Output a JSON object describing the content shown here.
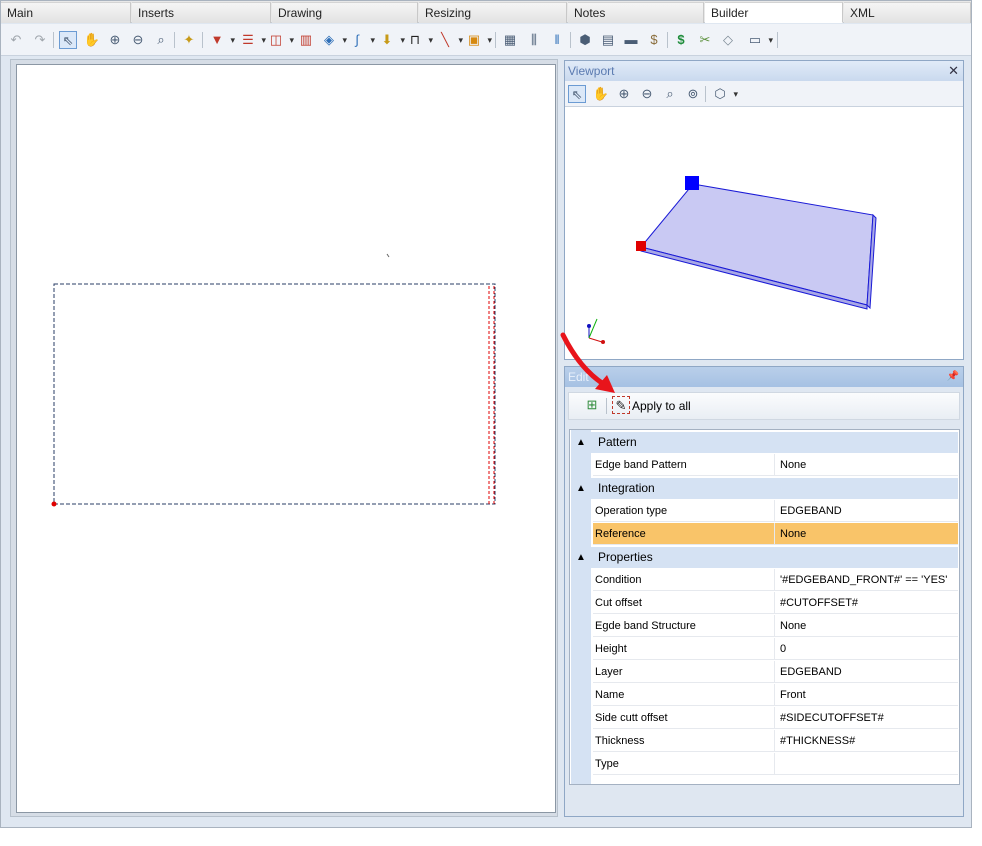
{
  "tabs": [
    {
      "label": "Main",
      "active": false
    },
    {
      "label": "Inserts",
      "active": false
    },
    {
      "label": "Drawing",
      "active": false
    },
    {
      "label": "Resizing",
      "active": false
    },
    {
      "label": "Notes",
      "active": false
    },
    {
      "label": "Builder",
      "active": true
    },
    {
      "label": "XML",
      "active": false
    }
  ],
  "toolbar": {
    "icons": [
      "undo-icon",
      "redo-icon",
      "select-icon",
      "pan-icon",
      "zoom-in-icon",
      "zoom-out-icon",
      "zoom-extents-icon",
      "new-item-icon",
      "hardware-icon",
      "panel-icon",
      "door-icon",
      "insert-icon",
      "part-icon",
      "curve-icon",
      "move-icon",
      "frame-icon",
      "line-icon",
      "material-icon",
      "calculator-icon",
      "columns-icon",
      "box-icon",
      "cabinet-icon",
      "drawer-icon",
      "money-bag-icon",
      "price-icon",
      "cut-icon",
      "edge-icon",
      "window-icon"
    ]
  },
  "viewport": {
    "title": "Viewport",
    "close": "✕",
    "tools": [
      "select-icon",
      "pan-icon",
      "zoom-in-icon",
      "zoom-out-icon",
      "zoom-extents-icon",
      "orbit-icon",
      "view-cube-icon"
    ]
  },
  "edit": {
    "title": "Edit",
    "pin": "📌",
    "apply_label": "Apply to all",
    "categories": [
      {
        "name": "Pattern",
        "rows": [
          {
            "key": "Edge band Pattern",
            "value": "None",
            "highlight": false
          }
        ]
      },
      {
        "name": "Integration",
        "rows": [
          {
            "key": "Operation type",
            "value": "EDGEBAND",
            "highlight": false
          },
          {
            "key": "Reference",
            "value": "None",
            "highlight": true
          }
        ]
      },
      {
        "name": "Properties",
        "rows": [
          {
            "key": "Condition",
            "value": "'#EDGEBAND_FRONT#' == 'YES'",
            "highlight": false
          },
          {
            "key": "Cut offset",
            "value": "#CUTOFFSET#",
            "highlight": false
          },
          {
            "key": "Egde band Structure",
            "value": "None",
            "highlight": false
          },
          {
            "key": "Height",
            "value": "0",
            "highlight": false
          },
          {
            "key": "Layer",
            "value": "EDGEBAND",
            "highlight": false
          },
          {
            "key": "Name",
            "value": "Front",
            "highlight": false
          },
          {
            "key": "Side cutt offset",
            "value": "#SIDECUTOFFSET#",
            "highlight": false
          },
          {
            "key": "Thickness",
            "value": "#THICKNESS#",
            "highlight": false
          },
          {
            "key": "Type",
            "value": "",
            "highlight": false
          }
        ]
      }
    ]
  },
  "colors": {
    "accent": "#5a7ab0",
    "highlight_row": "#f9c469",
    "annotation_arrow": "#e8141b",
    "panel_fill": "#c9c9f3",
    "anchor_blue": "#0000ff",
    "anchor_red": "#e00000"
  }
}
